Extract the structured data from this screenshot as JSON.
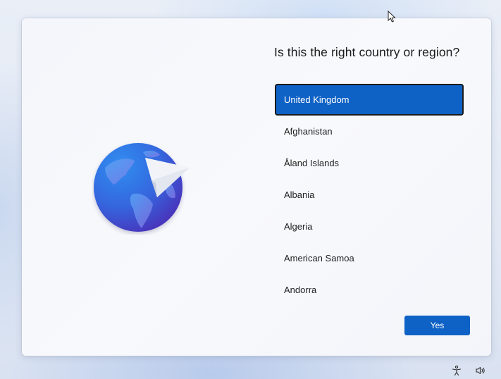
{
  "dialog": {
    "title": "Is this the right country or region?",
    "items": [
      {
        "label": "United Kingdom",
        "selected": true
      },
      {
        "label": "Afghanistan",
        "selected": false
      },
      {
        "label": "Åland Islands",
        "selected": false
      },
      {
        "label": "Albania",
        "selected": false
      },
      {
        "label": "Algeria",
        "selected": false
      },
      {
        "label": "American Samoa",
        "selected": false
      },
      {
        "label": "Andorra",
        "selected": false
      }
    ],
    "yes_label": "Yes"
  },
  "tray": {
    "accessibility_icon": "accessibility-icon",
    "volume_icon": "volume-icon"
  },
  "illustration": {
    "icon": "globe-paper-plane-icon"
  },
  "colors": {
    "accent": "#0f62c5",
    "globe_dark": "#3a2fb8",
    "globe_light": "#2f8ef0"
  }
}
